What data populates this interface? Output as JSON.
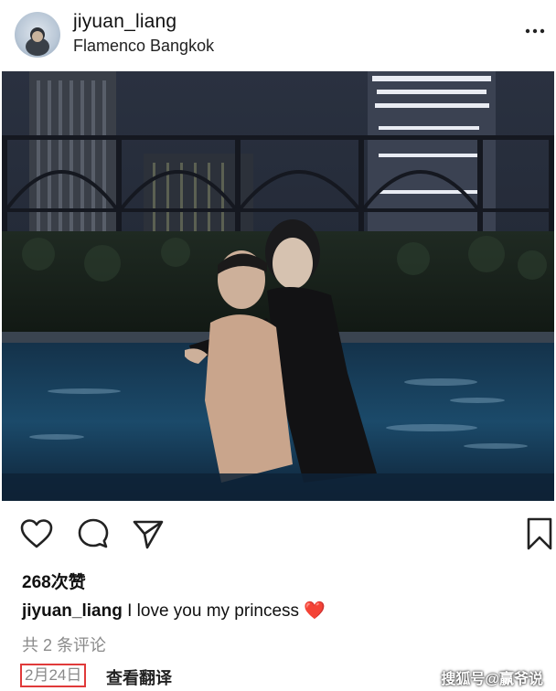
{
  "post": {
    "username": "jiyuan_liang",
    "location": "Flamenco Bangkok",
    "avatar_alt": "avatar",
    "more_icon": "more-dots-icon"
  },
  "actions": {
    "icons": [
      "heart-icon",
      "comment-icon",
      "share-send-icon",
      "bookmark-icon"
    ]
  },
  "likes": "268次赞",
  "caption": {
    "username": "jiyuan_liang",
    "text": "I love you my princess",
    "emoji": "❤️"
  },
  "comments_link": "共 2 条评论",
  "date": "2月24日",
  "translate_label": "查看翻译",
  "watermark": "搜狐号@赢爷说",
  "colors": {
    "date_highlight_border": "#e03a3a",
    "muted_text": "#8a8a8a",
    "heart_emoji": "#e0245e"
  }
}
